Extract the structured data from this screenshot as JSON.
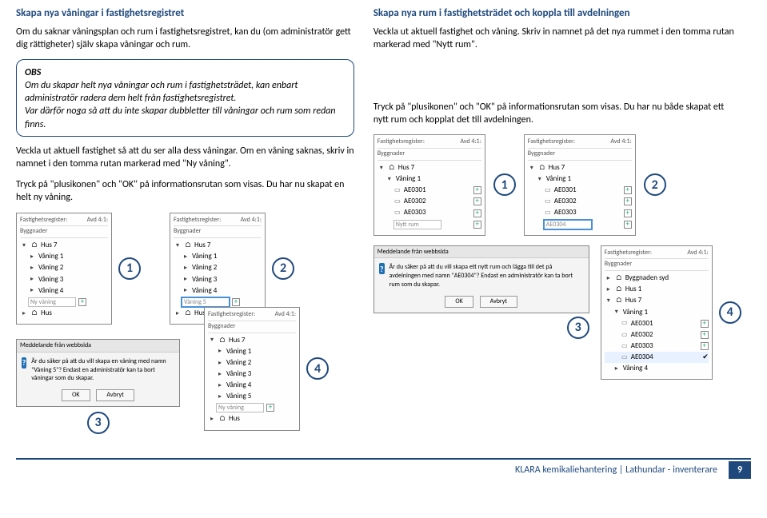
{
  "left": {
    "title": "Skapa nya våningar i fastighetsregistret",
    "p1": "Om du saknar våningsplan och rum i fastighetsregistret, kan du (om administratör gett dig rättigheter) själv skapa våningar och rum.",
    "callout_obs": "OBS",
    "callout_body1": "Om du skapar helt nya våningar och rum i fastighetsträdet, kan enbart administratör radera dem helt från fastighetsregistret.",
    "callout_body2": "Var därför noga så att du inte skapar dubbletter till våningar och rum som redan finns.",
    "p2": "Veckla ut aktuell fastighet så att du ser alla dess våningar. Om en våning saknas, skriv in namnet i den tomma rutan markerad med \"Ny våning\".",
    "p3": "Tryck på \"plusikonen\" och \"OK\" på informationsrutan som visas. Du har nu skapat en helt ny våning.",
    "step1": "1",
    "step2": "2",
    "step3": "3",
    "step4": "4"
  },
  "right": {
    "title": "Skapa nya rum i fastighetsträdet och koppla till avdelningen",
    "p1": "Veckla ut aktuell fastighet och våning. Skriv in namnet på det nya rummet i den tomma rutan markerad med \"Nytt rum\".",
    "p2": "Tryck på \"plusikonen\" och \"OK\" på informationsrutan som visas. Du har nu både skapat ett nytt rum och kopplat det till avdelningen.",
    "step1": "1",
    "step2": "2",
    "step3": "3",
    "step4": "4"
  },
  "tree": {
    "header_l": "Fastighetsregister:",
    "header_r": "Avd 4:1:",
    "subhead": "Byggnader",
    "hus7": "Hus 7",
    "hus": "Hus",
    "vaning1": "Våning 1",
    "vaning2": "Våning 2",
    "vaning3": "Våning 3",
    "vaning4": "Våning 4",
    "vaning5": "Våning 5",
    "ny_vaning_ph": "Ny våning",
    "ny_vaning_val": "Våning 5",
    "nytt_rum_ph": "Nytt rum",
    "room1": "AE0301",
    "room2": "AE0302",
    "room3": "AE0303",
    "room4": "AE0304",
    "bygg_syd": "Byggnaden syd",
    "hus1": "Hus 1"
  },
  "dialog": {
    "title": "Meddelande från webbsida",
    "msg1": "Är du säker på att du vill skapa en våning med namn \"Våning 5\"? Endast en administratör kan ta bort våningar som du skapar.",
    "msg2": "Är du säker på att du vill skapa ett nytt rum och lägga till det på avdelningen med namn \"AE0304\"? Endast en administratör kan ta bort rum som du skapar.",
    "ok": "OK",
    "cancel": "Avbryt"
  },
  "footer": {
    "text": "KLARA kemikaliehantering | Lathundar - inventerare",
    "page": "9"
  }
}
